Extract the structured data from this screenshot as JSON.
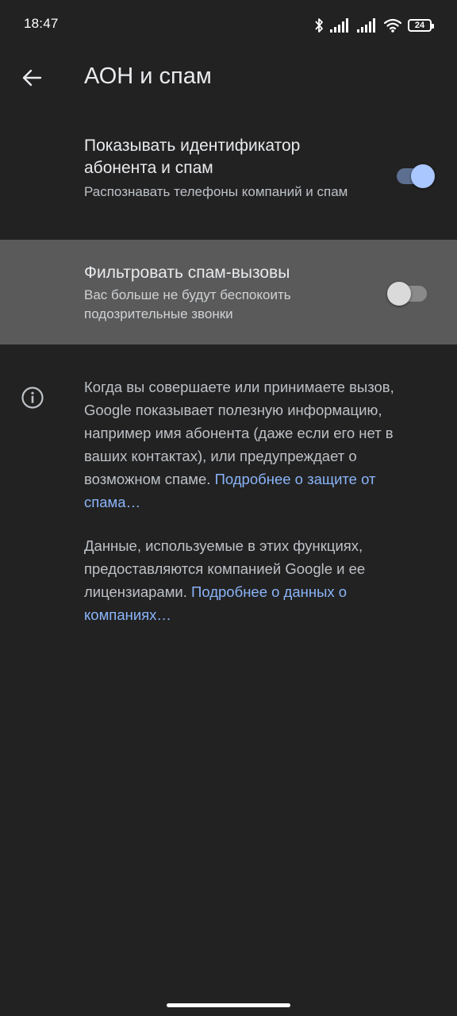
{
  "status_bar": {
    "time": "18:47",
    "battery_level": "24",
    "icons": [
      "bluetooth-icon",
      "signal-icon",
      "signal-icon",
      "wifi-icon",
      "battery-icon"
    ]
  },
  "app_bar": {
    "title": "АОН и спам",
    "back_icon": "arrow-left-icon"
  },
  "settings": {
    "caller_id": {
      "title": "Показывать идентификатор абонента и спам",
      "subtitle": "Распознавать телефоны компаний и спам",
      "enabled": true
    },
    "spam_filter": {
      "title": "Фильтровать спам-вызовы",
      "subtitle": "Вас больше не будут беспокоить подозрительные звонки",
      "enabled": false
    }
  },
  "info": {
    "icon": "info-icon",
    "paragraph_1": "Когда вы совершаете или принимаете вызов, Google показывает полезную информацию, например имя абонента (даже если его нет в ваших контактах), или предупреждает о возможном спаме.",
    "link_1": "Подробнее о защите от спама…",
    "paragraph_2": "Данные, используемые в этих функциях, предоставляются компанией Google и ее лицензиарами.",
    "link_2": "Подробнее о данных о компаниях…"
  },
  "colors": {
    "background": "#222222",
    "highlight_row": "#5a5a5a",
    "accent": "#aac7ff",
    "link": "#8ab4f8"
  }
}
